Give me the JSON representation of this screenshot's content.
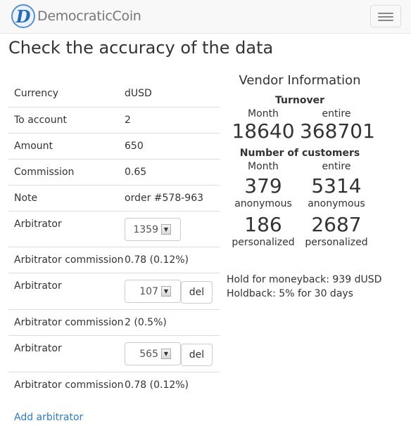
{
  "app": {
    "logo_letter": "D",
    "name": "DemocraticCoin"
  },
  "page_title": "Check the accuracy of the data",
  "rows": [
    {
      "label": "Currency",
      "value": "dUSD"
    },
    {
      "label": "To account",
      "value": "2"
    },
    {
      "label": "Amount",
      "value": "650"
    },
    {
      "label": "Commission",
      "value": "0.65"
    },
    {
      "label": "Note",
      "value": "order #578-963"
    }
  ],
  "arbitrators": [
    {
      "label": "Arbitrator",
      "id": "1359",
      "commission_label": "Arbitrator commission",
      "commission": "0.78 (0.12%)"
    },
    {
      "label": "Arbitrator",
      "id": "107",
      "del_label": "del",
      "commission_label": "Arbitrator commission",
      "commission": "2 (0.5%)"
    },
    {
      "label": "Arbitrator",
      "id": "565",
      "del_label": "del",
      "commission_label": "Arbitrator commission",
      "commission": "0.78 (0.12%)"
    }
  ],
  "add_arbitrator": "Add arbitrator",
  "vendor": {
    "title": "Vendor Information",
    "turnover": {
      "label": "Turnover",
      "month_label": "Month",
      "entire_label": "entire",
      "month": "18640",
      "entire": "368701"
    },
    "customers": {
      "label": "Number of customers",
      "month_label": "Month",
      "entire_label": "entire",
      "anonymous_label": "anonymous",
      "personalized_label": "personalized",
      "anonymous_month": "379",
      "anonymous_entire": "5314",
      "personalized_month": "186",
      "personalized_entire": "2687"
    },
    "hold": "Hold for moneyback: 939 dUSD",
    "holdback": "Holdback: 5% for 30 days"
  },
  "colors": {
    "link": "#337ab7",
    "navbar_bg": "#f8f8f8",
    "logo_blue": "#2a6bb5"
  },
  "icons": {
    "menu": "hamburger-icon",
    "spin": "spin-down-icon"
  }
}
